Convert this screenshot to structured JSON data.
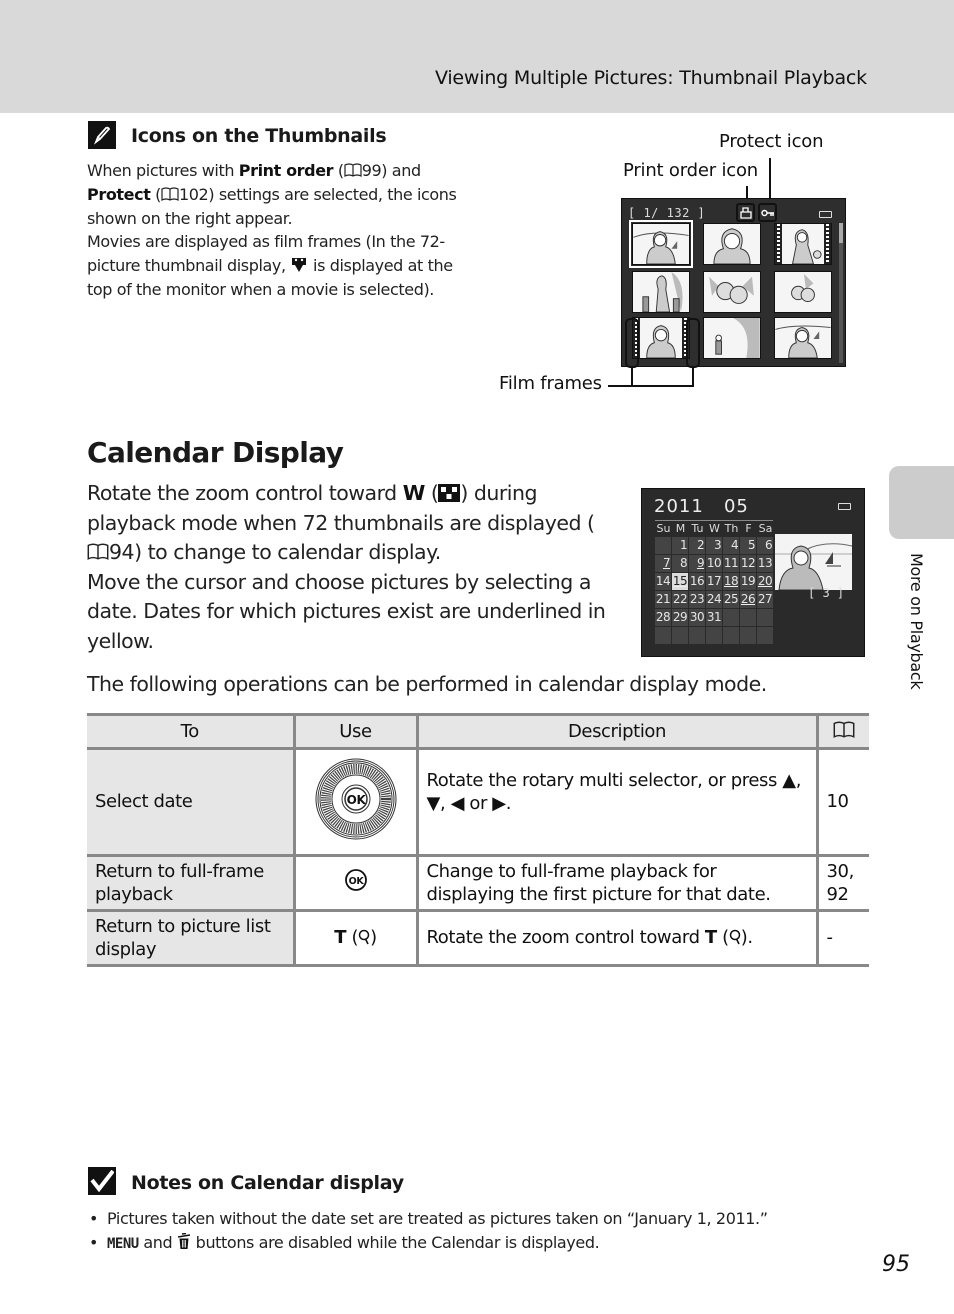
{
  "header": {
    "title": "Viewing Multiple Pictures: Thumbnail Playback"
  },
  "tip": {
    "icon": "pencil-icon",
    "title": "Icons on the Thumbnails",
    "p1_a": "When pictures with ",
    "p1_b1": "Print order",
    "p1_c": " (",
    "p1_ref1": "99",
    "p1_d": ") and ",
    "p1_b2": "Protect",
    "p1_e": " (",
    "p1_ref2": "102",
    "p1_f": ") settings are selected, the icons shown on the right appear.",
    "p2_a": "Movies are displayed as film frames (In the 72-picture thumbnail display, ",
    "p2_b": " is displayed at the top of the monitor when a movie is selected)."
  },
  "thumbnail_figure": {
    "labels": {
      "protect": "Protect icon",
      "print_order": "Print order icon",
      "film_frames": "Film frames"
    },
    "counter": "[     1/  132 ]",
    "current": 1,
    "total": 132
  },
  "calendar_section": {
    "title": "Calendar Display",
    "p1_a": "Rotate the zoom control toward ",
    "p1_w": "W",
    "p1_b": " (",
    "p1_c": ") during playback mode when 72 thumbnails are displayed (",
    "p1_ref": "94",
    "p1_d": ") to change to calendar display.",
    "p2": "Move the cursor and choose pictures by selecting a date. Dates for which pictures exist are underlined in yellow.",
    "following": "The following operations can be performed in calendar display mode."
  },
  "calendar_screen": {
    "year": "2011",
    "month": "05",
    "weekdays": [
      "Su",
      "M",
      "Tu",
      "W",
      "Th",
      "F",
      "Sa"
    ],
    "days": [
      "",
      "1",
      "2",
      "3",
      "4",
      "5",
      "6",
      "7",
      "8",
      "9",
      "10",
      "11",
      "12",
      "13",
      "14",
      "15",
      "16",
      "17",
      "18",
      "19",
      "20",
      "21",
      "22",
      "23",
      "24",
      "25",
      "26",
      "27",
      "28",
      "29",
      "30",
      "31"
    ],
    "underlined": [
      "7",
      "9",
      "15",
      "18",
      "20",
      "26"
    ],
    "selected": "15",
    "count": "[      3 ]"
  },
  "table": {
    "headers": {
      "to": "To",
      "use": "Use",
      "description": "Description",
      "ref": "book-icon"
    },
    "rows": [
      {
        "to": "Select date",
        "use": "rotary-multi-selector-icon",
        "description_a": "Rotate the rotary multi selector, or press ",
        "description_b": "▲, ▼, ◀ or ▶.",
        "ref": "10"
      },
      {
        "to": "Return to full-frame playback",
        "use": "ok-button-icon",
        "description": "Change to full-frame playback for displaying the first picture for that date.",
        "ref": "30, 92"
      },
      {
        "to": "Return to picture list display",
        "use_t": "T",
        "use_icon": "magnify-icon",
        "description_a": "Rotate the zoom control toward ",
        "description_t": "T",
        "description_b": ").",
        "ref": "-"
      }
    ]
  },
  "notes": {
    "icon": "check-icon",
    "title": "Notes on Calendar display",
    "items": [
      {
        "text": "Pictures taken without the date set are treated as pictures taken on “January 1, 2011.”"
      },
      {
        "menu": "MENU",
        "text_a": " and ",
        "text_b": " buttons are disabled while the Calendar is displayed."
      }
    ]
  },
  "side_tab": {
    "label": "More on Playback"
  },
  "page_number": "95"
}
